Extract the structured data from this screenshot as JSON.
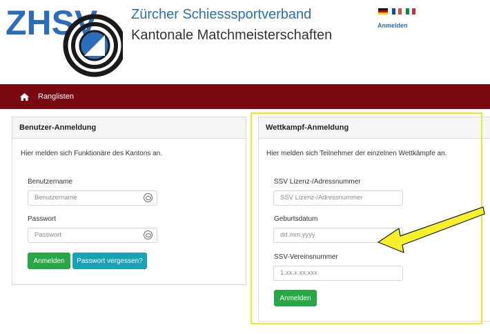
{
  "brand": {
    "logo_text": "ZHSV",
    "org_name": "Zürcher Schiesssportverband",
    "event_name": "Kantonale Matchmeisterschaften"
  },
  "header": {
    "login_link": "Anmelden",
    "flags": [
      "german-flag-icon",
      "french-flag-icon",
      "italian-flag-icon"
    ]
  },
  "navbar": {
    "home_icon": "home-icon",
    "link": "Ranglisten"
  },
  "user_login": {
    "title": "Benutzer-Anmeldung",
    "description": "Hier melden sich Funktionäre des Kantons an.",
    "username_label": "Benutzername",
    "username_placeholder": "Benutzername",
    "password_label": "Passwort",
    "password_placeholder": "Passwort",
    "login_button": "Anmelden",
    "forgot_button": "Passwort vergessen?"
  },
  "competition_login": {
    "title": "Wettkampf-Anmeldung",
    "description": "Hier melden sich Teilnehmer der einzelnen Wettkämpfe an.",
    "license_label": "SSV Lizenz-/Adressnummer",
    "license_placeholder": "SSV Lizenz-/Adressnummer",
    "birthdate_label": "Geburtsdatum",
    "birthdate_placeholder": "dd.mm.yyyy",
    "club_label": "SSV-Vereinsnummer",
    "club_placeholder": "1.xx.x.xx.xxx",
    "login_button": "Anmelden"
  },
  "colors": {
    "navbar": "#7a0a12",
    "brand_blue": "#2a6ebb",
    "button_green": "#28a745",
    "button_teal": "#17a2b8",
    "highlight_yellow": "#f2ea1a"
  }
}
